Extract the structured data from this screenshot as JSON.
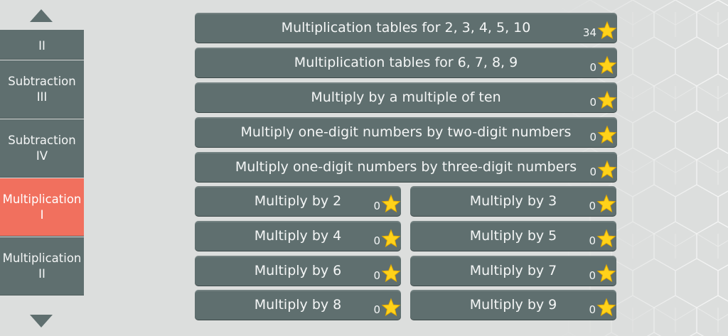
{
  "sidebar": {
    "up_icon": "triangle-up-icon",
    "down_icon": "triangle-down-icon",
    "items": [
      {
        "line1": "",
        "line2": "II",
        "active": false
      },
      {
        "line1": "Subtraction",
        "line2": "III",
        "active": false
      },
      {
        "line1": "Subtraction",
        "line2": "IV",
        "active": false
      },
      {
        "line1": "Multiplication",
        "line2": "I",
        "active": true
      },
      {
        "line1": "Multiplication",
        "line2": "II",
        "active": false
      }
    ]
  },
  "lessons": [
    {
      "title": "Multiplication tables for 2, 3, 4, 5, 10",
      "stars": "34"
    },
    {
      "title": "Multiplication tables for 6, 7, 8, 9",
      "stars": "0"
    },
    {
      "title": "Multiply by a multiple of ten",
      "stars": "0"
    },
    {
      "title": "Multiply one-digit numbers by two-digit numbers",
      "stars": "0"
    },
    {
      "title": "Multiply one-digit numbers by three-digit numbers",
      "stars": "0"
    },
    {
      "title": "Multiply by 2",
      "stars": "0"
    },
    {
      "title": "Multiply by 3",
      "stars": "0"
    },
    {
      "title": "Multiply by 4",
      "stars": "0"
    },
    {
      "title": "Multiply by 5",
      "stars": "0"
    },
    {
      "title": "Multiply by 6",
      "stars": "0"
    },
    {
      "title": "Multiply by 7",
      "stars": "0"
    },
    {
      "title": "Multiply by 8",
      "stars": "0"
    },
    {
      "title": "Multiply by 9",
      "stars": "0"
    }
  ],
  "icons": {
    "star": "star-icon"
  },
  "colors": {
    "button": "#5f6f6f",
    "active": "#f1705e",
    "star": "#ffd21a",
    "background": "#dcdedd"
  }
}
